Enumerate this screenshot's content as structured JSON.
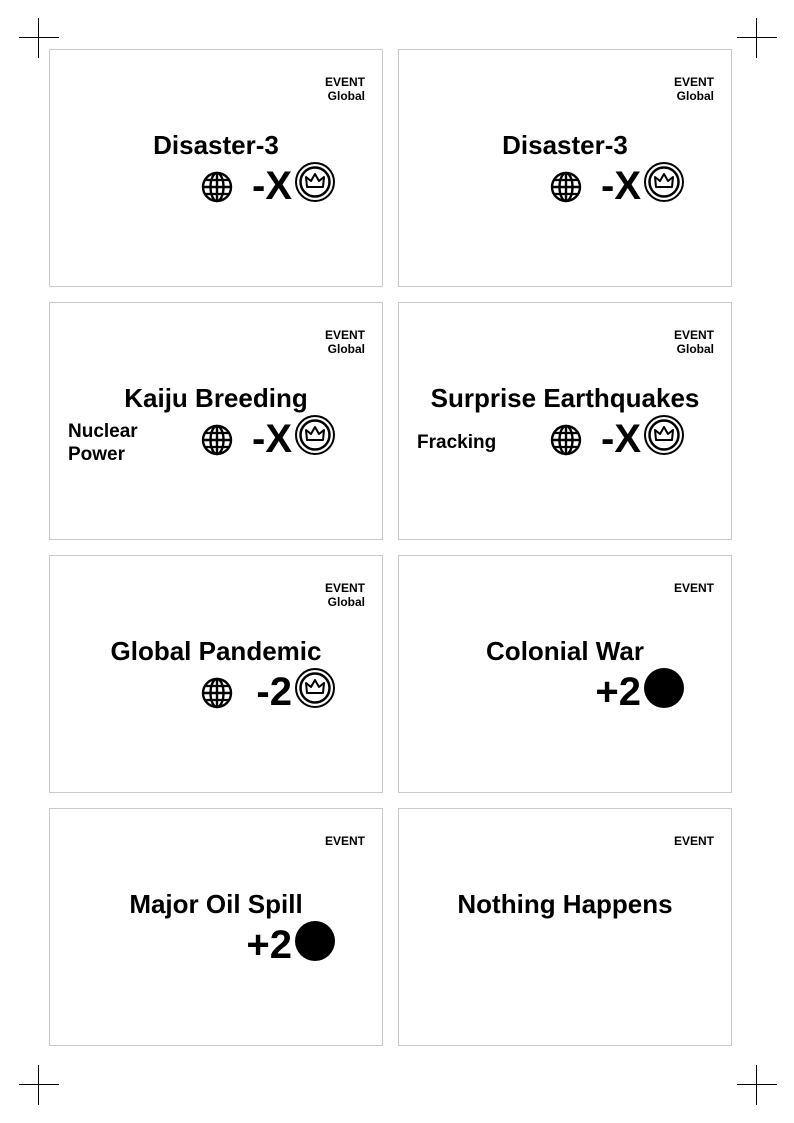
{
  "cards": [
    {
      "type": "EVENT",
      "scope": "Global",
      "title": "Disaster-3",
      "requirement": "",
      "value": "-X",
      "icon": "crown-coin-icon",
      "globe": true
    },
    {
      "type": "EVENT",
      "scope": "Global",
      "title": "Disaster-3",
      "requirement": "",
      "value": "-X",
      "icon": "crown-coin-icon",
      "globe": true
    },
    {
      "type": "EVENT",
      "scope": "Global",
      "title": "Kaiju Breeding",
      "requirement": "Nuclear Power",
      "value": "-X",
      "icon": "crown-coin-icon",
      "globe": true
    },
    {
      "type": "EVENT",
      "scope": "Global",
      "title": "Surprise Earthquakes",
      "requirement": "Fracking",
      "value": "-X",
      "icon": "crown-coin-icon",
      "globe": true
    },
    {
      "type": "EVENT",
      "scope": "Global",
      "title": "Global Pandemic",
      "requirement": "",
      "value": "-2",
      "icon": "crown-coin-icon",
      "globe": true
    },
    {
      "type": "EVENT",
      "scope": "",
      "title": "Colonial War",
      "requirement": "",
      "value": "+2",
      "icon": "black-dot-icon",
      "globe": false
    },
    {
      "type": "EVENT",
      "scope": "",
      "title": "Major Oil Spill",
      "requirement": "",
      "value": "+2",
      "icon": "black-dot-icon",
      "globe": false
    },
    {
      "type": "EVENT",
      "scope": "",
      "title": "Nothing Happens",
      "requirement": "",
      "value": "",
      "icon": "",
      "globe": false
    }
  ]
}
